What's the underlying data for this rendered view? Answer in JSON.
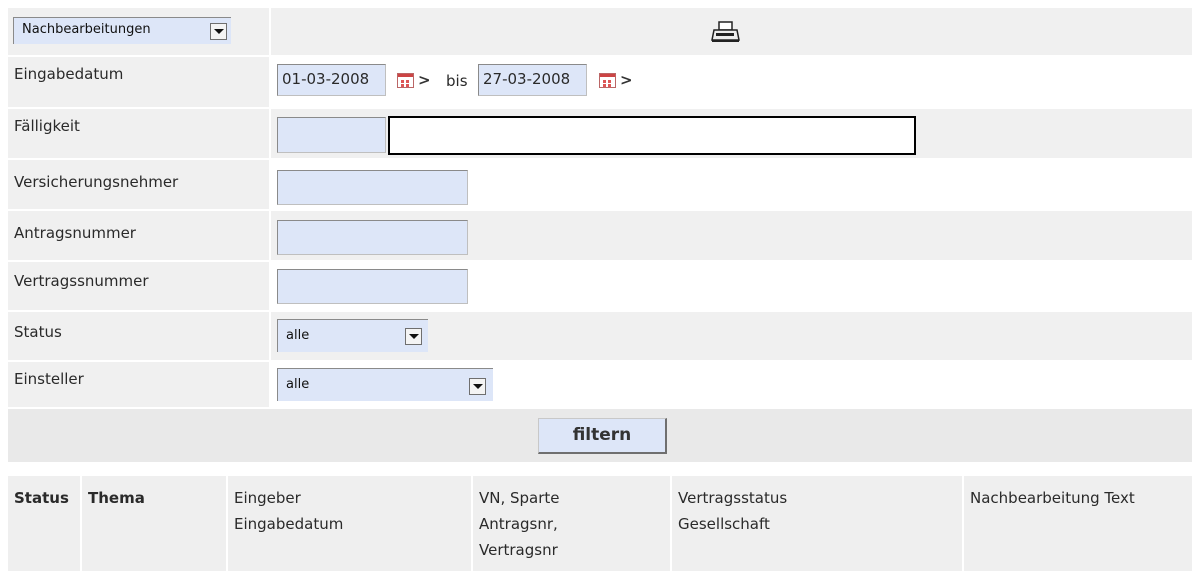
{
  "top": {
    "view_select": "Nachbearbeitungen"
  },
  "form": {
    "eingabedatum": {
      "label": "Eingabedatum",
      "from": "01-03-2008",
      "connector": "bis",
      "to": "27-03-2008"
    },
    "faelligkeit": {
      "label": "Fälligkeit"
    },
    "versicherungsnehmer": {
      "label": "Versicherungsnehmer"
    },
    "antragsnummer": {
      "label": "Antragsnummer"
    },
    "vertragsnummer": {
      "label": "Vertragssnummer"
    },
    "status": {
      "label": "Status",
      "value": "alle"
    },
    "einsteller": {
      "label": "Einsteller",
      "value": "alle"
    },
    "filter_button": "filtern"
  },
  "table": {
    "headers": [
      "Status",
      "Thema",
      "Eingeber\nEingabedatum",
      "VN, Sparte\nAntragsnr,\nVertragsnr",
      "Vertragsstatus\nGesellschaft",
      "Nachbearbeitung Text"
    ]
  }
}
